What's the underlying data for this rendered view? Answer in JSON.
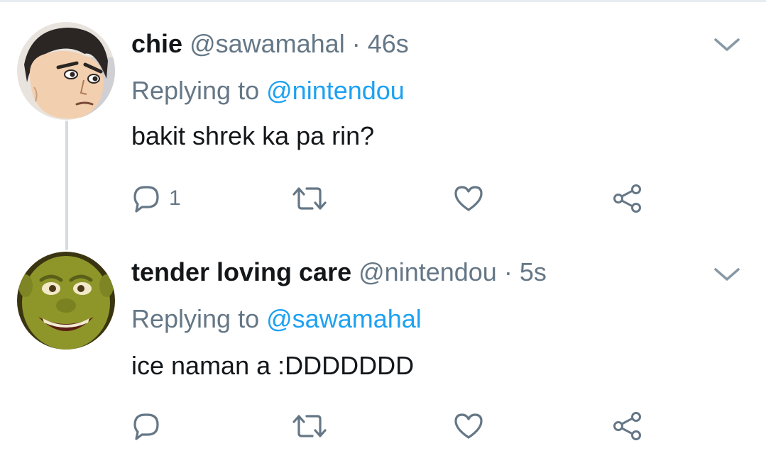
{
  "tweets": [
    {
      "name": "chie",
      "handle": "@sawamahal",
      "separator": "·",
      "time": "46s",
      "replying_prefix": "Replying to",
      "replying_to": "@nintendou",
      "text": "bakit shrek ka pa rin?",
      "reply_count": "1",
      "avatar_icon": "anime-character-avatar"
    },
    {
      "name": "tender loving care",
      "handle": "@nintendou",
      "separator": "·",
      "time": "5s",
      "replying_prefix": "Replying to",
      "replying_to": "@sawamahal",
      "text": "ice naman a :DDDDDDD",
      "reply_count": "",
      "avatar_icon": "shrek-face-avatar"
    }
  ],
  "icons": {
    "reply": "reply-bubble-icon",
    "retweet": "retweet-icon",
    "like": "heart-icon",
    "share": "share-icon",
    "more": "chevron-down-icon"
  },
  "colors": {
    "text": "#14171a",
    "muted": "#657786",
    "link": "#1da1f2",
    "thread_line": "#d6dbdf"
  }
}
